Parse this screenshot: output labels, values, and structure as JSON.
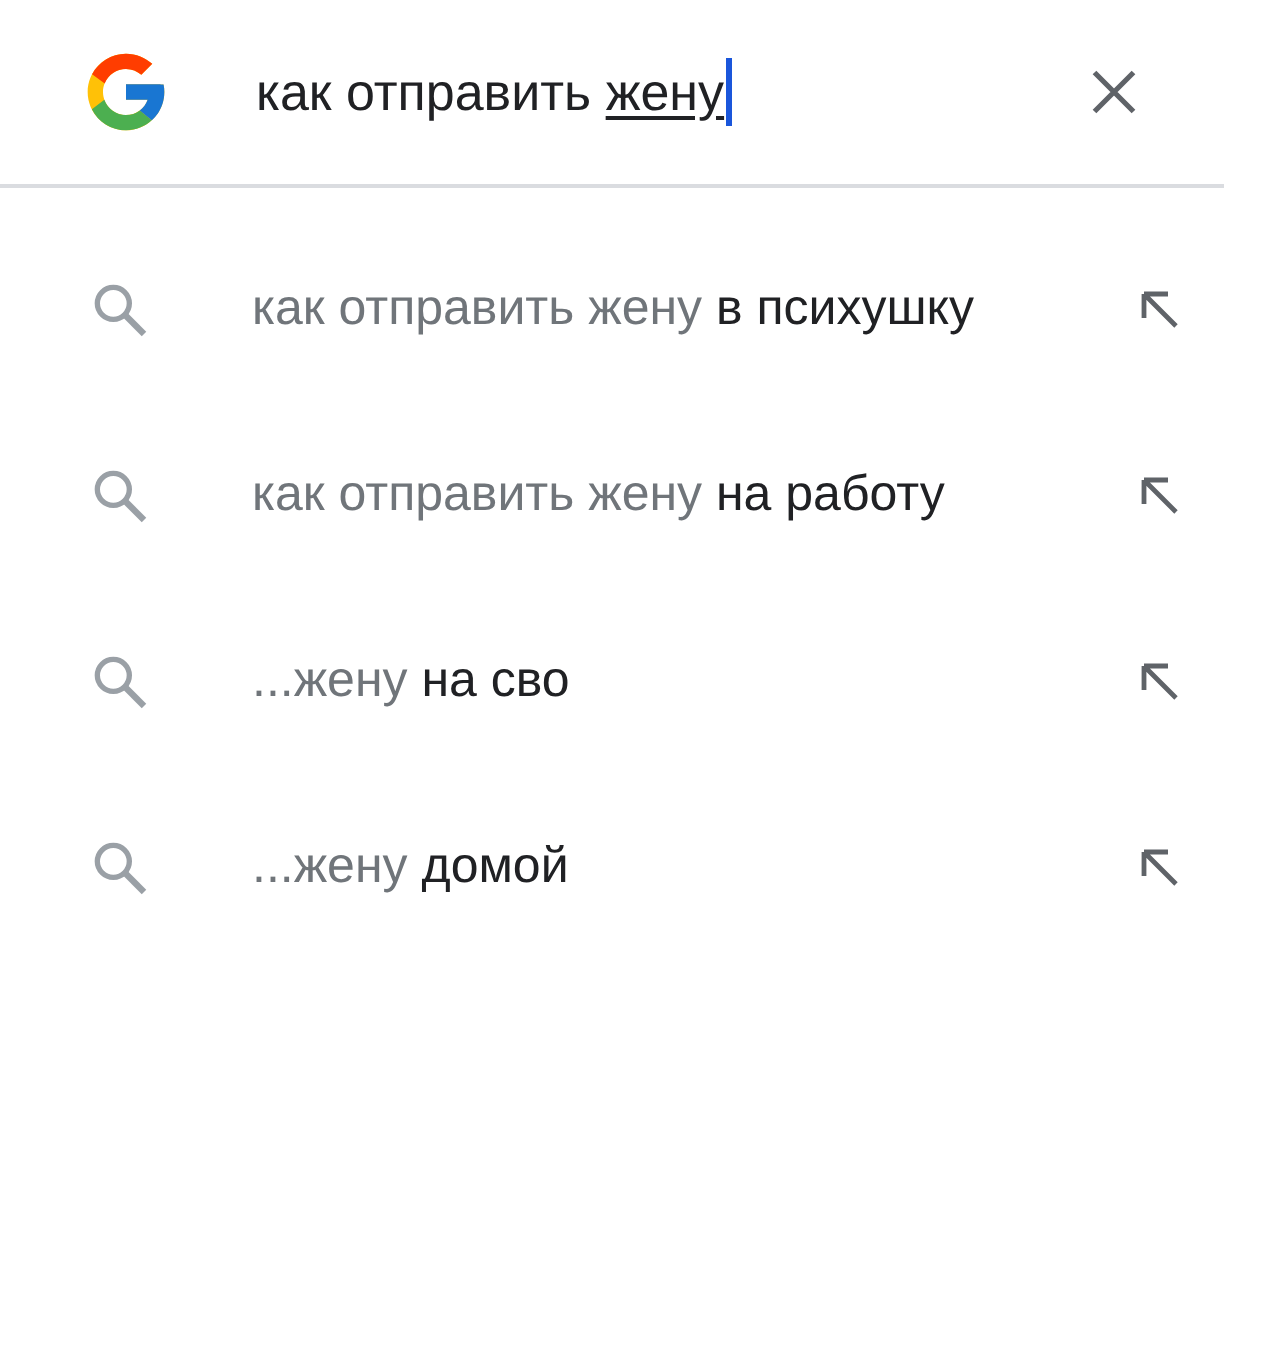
{
  "search": {
    "text": "как отправить ",
    "composing": "жену"
  },
  "suggestions": [
    {
      "prefix": "как отправить жену",
      "completion": "в психушку"
    },
    {
      "prefix": "как отправить жену",
      "completion": "на работу"
    },
    {
      "prefix": "...жену",
      "completion": "на сво"
    },
    {
      "prefix": "...жену",
      "completion": "домой"
    }
  ]
}
